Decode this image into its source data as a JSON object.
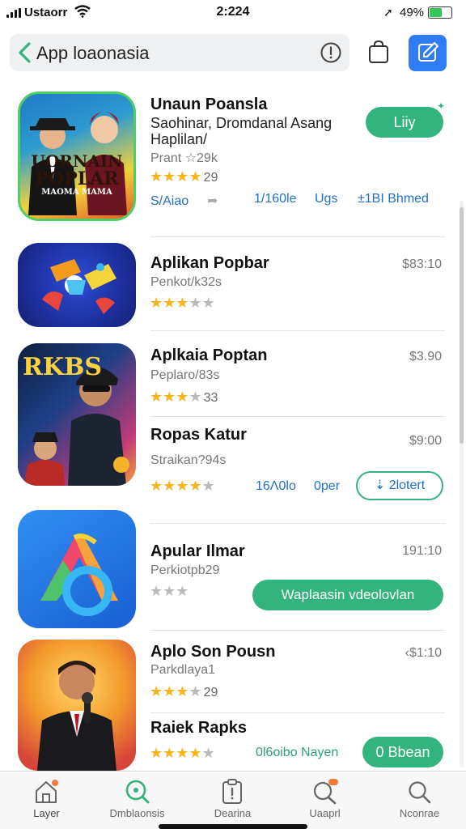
{
  "status": {
    "carrier": "Ustaorr",
    "time": "2:224",
    "battery": "49%"
  },
  "nav": {
    "title": "App loaonasia"
  },
  "apps": [
    {
      "name": "Unaun Poansla",
      "desc1": "Saohinar, Dromdanal Asang",
      "desc2": "Haplilan/",
      "sub": "Prant ☆29k",
      "rating": 4,
      "rating_count": "29",
      "button": "Liiy",
      "links": [
        "S/Aiao",
        "1/160le",
        "Ugs",
        "±1BI Bhmed"
      ],
      "icon_text": [
        "UORNAIN",
        "POPLAR",
        "MAOMA MAMA"
      ]
    },
    {
      "name": "Aplikan Popbar",
      "sub": "Penkot/k32s",
      "rating": 3,
      "rating_count": "",
      "price": "$83:10"
    },
    {
      "name": "Aplkaia Poptan",
      "sub": "Peplaro/83s",
      "rating": 3,
      "rating_count": "33",
      "price": "$3.90",
      "icon_text": "RKBS"
    },
    {
      "name": "Ropas Katur",
      "sub": "Straikan?94s",
      "rating": 4,
      "rating_count": "",
      "price": "$9:00",
      "links": [
        "16Λ0lo",
        "0per"
      ],
      "button": "2lotert"
    },
    {
      "name": "Apular Ilmar",
      "sub": "Perkiotpb29",
      "rating": 3,
      "rating_count": "",
      "price": "191:10",
      "button": "Waplaasin vdeolovlan"
    },
    {
      "name": "Aplo Son Pousn",
      "sub": "Parkdlaya1",
      "rating": 3,
      "rating_count": "29",
      "price": "‹$1:10"
    },
    {
      "name": "Raiek Rapks",
      "rating": 4,
      "rating_count": "",
      "links": [
        "0l6oibo Nayen"
      ],
      "button": "0 Bbean"
    }
  ],
  "tabs": [
    {
      "label": "Layer",
      "icon": "home-icon",
      "badge": true
    },
    {
      "label": "Dmblaonsis",
      "icon": "discover-icon",
      "badge": false
    },
    {
      "label": "Dearina",
      "icon": "clipboard-icon",
      "badge": false
    },
    {
      "label": "Uaaprl",
      "icon": "search-badge-icon",
      "badge": true
    },
    {
      "label": "Nconrae",
      "icon": "search-icon",
      "badge": false
    }
  ],
  "colors": {
    "accent_green": "#33b37e",
    "accent_blue": "#2f7df6",
    "link_blue": "#1f6fc8",
    "star": "#f5b51c"
  }
}
